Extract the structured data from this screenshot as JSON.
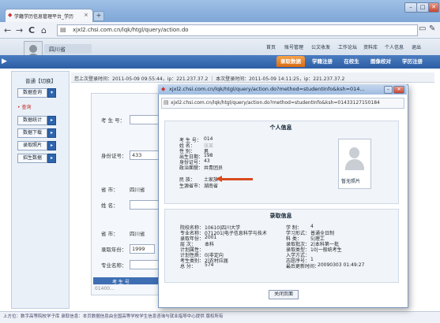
{
  "browser": {
    "tab_title": "学籍学历信息管理平台_学历",
    "tab_close": "×",
    "new_tab": "+",
    "win_min": "–",
    "win_max": "□",
    "win_close": "✕",
    "back": "←",
    "forward": "→",
    "reload": "C",
    "home": "⌂",
    "url": "xjxl2.chsi.com.cn/lqk/htgl/query/action.do"
  },
  "header": {
    "province": "四川省",
    "top_links": [
      "首页",
      "账号管理",
      "公文收发",
      "工作论坛",
      "资料库",
      "个人信息",
      "退出"
    ],
    "tabs": [
      "录取数据",
      "学籍注册",
      "在校生",
      "图像校对",
      "学历注册"
    ],
    "active_tab": 0
  },
  "sidebar": {
    "title": "普通【切换】",
    "items": [
      "数据查询",
      "数据统计",
      "数据下载",
      "录取照片",
      "招生数据"
    ],
    "query_link": "• 查询"
  },
  "login_info": "您上次登录时间：2011-05-09 09:55:44，ip：221.237.37.2 ｜ 本次登录时间：2011-05-09 14:11:25，ip：221.237.37.2",
  "form": {
    "exam_no_label": "考 生 号：",
    "id_label": "身份证号：",
    "id_value": "433",
    "province_label": "省   市：",
    "province_value": "四川省",
    "name_label": "姓   名：",
    "province2_label": "省   市：",
    "province2_value": "四川省",
    "year_label": "录取年份：",
    "year_value": "1999",
    "school_label": "专业名称：",
    "table_header": "考 生 号",
    "table_cell": "01400..."
  },
  "status_bar": "上方位：数字高等院校学子库    录取信息：本页数据信息由全国高等学校学生信息咨询与就业指导中心提供  版权所有",
  "popup": {
    "window_title": "xjxl2.chsi.com.cn/lqk/htgl/query/action.do?method=studentInfo&ksh=014...",
    "url": "xjxl2.chsi.com.cn/lqk/htgl/query/action.do?method=studentInfo&ksh=01433127150184",
    "personal_title": "个人信息",
    "personal": [
      [
        "考 生 号：",
        "014"
      ],
      [
        "姓    名：",
        "张某"
      ],
      [
        "性    别：",
        "男"
      ],
      [
        "出生日期：",
        "198"
      ],
      [
        "身份证号：",
        "43"
      ],
      [
        "政治面貌：",
        "共青团员"
      ],
      [
        "民    族：",
        "土家族"
      ],
      [
        "生源省市：",
        "湖南省"
      ]
    ],
    "photo_caption": "暂无照片",
    "admission_title": "录取信息",
    "admission_left": [
      [
        "院校名称：",
        "10610|四川大学"
      ],
      [
        "专业名称：",
        "071201|电子信息科学与技术"
      ],
      [
        "录取年份：",
        "2001"
      ],
      [
        "层    次：",
        "本科"
      ],
      [
        "计划属性：",
        ""
      ],
      [
        "计划性质：",
        "0|非定向"
      ],
      [
        "考生类别：",
        "2|农村应届"
      ],
      [
        "总    分：",
        "574"
      ]
    ],
    "admission_right": [
      [
        "学    制：",
        "4"
      ],
      [
        "学习形式：",
        "普通全日制"
      ],
      [
        "科    类：",
        "5|理工"
      ],
      [
        "录取批次：",
        "2|本科第一批"
      ],
      [
        "录取类型：",
        "10|一般统考生"
      ],
      [
        "入学方式：",
        ""
      ],
      [
        "志愿序号：",
        "1"
      ],
      [
        "最后更新时间：",
        "20090303 01:49:27"
      ]
    ],
    "close_button": "关闭页面"
  }
}
